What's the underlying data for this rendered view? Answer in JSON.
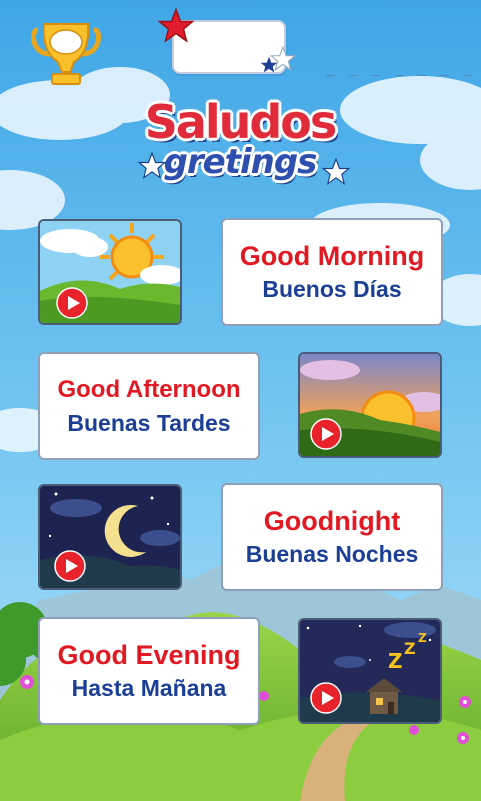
{
  "header": {
    "trophy_icon": "trophy-icon",
    "score_value": "",
    "progress_placeholder": "_ _ _ _ _ _ _"
  },
  "title": {
    "main": "Saludos",
    "sub": "gretings"
  },
  "greetings": [
    {
      "english": "Good Morning",
      "spanish": "Buenos Días",
      "thumbnail_icon": "sunny-hills-icon"
    },
    {
      "english": "Good Afternoon",
      "spanish": "Buenas Tardes",
      "thumbnail_icon": "sunset-icon"
    },
    {
      "english": "Goodnight",
      "spanish": "Buenas Noches",
      "thumbnail_icon": "moon-night-icon"
    },
    {
      "english": "Good Evening",
      "spanish": "Hasta Mañana",
      "thumbnail_icon": "sleeping-house-icon"
    }
  ],
  "colors": {
    "english_text": "#e21822",
    "spanish_text": "#1c3f96",
    "play_button": "#e8232b",
    "sky": "#5ab6ec",
    "grass": "#7cc23a"
  }
}
